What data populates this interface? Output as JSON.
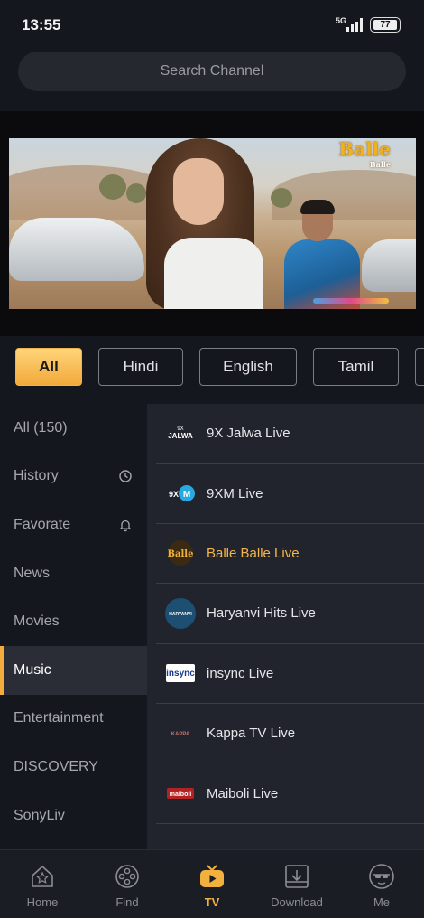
{
  "status_bar": {
    "time": "13:55",
    "network": "5G",
    "battery": "77"
  },
  "search": {
    "placeholder": "Search Channel"
  },
  "player": {
    "channel_logo_text": "Balle",
    "channel_logo_sub": "Balle"
  },
  "languages": [
    {
      "label": "All",
      "active": true
    },
    {
      "label": "Hindi",
      "active": false
    },
    {
      "label": "English",
      "active": false
    },
    {
      "label": "Tamil",
      "active": false
    }
  ],
  "categories": [
    {
      "label": "All (150)",
      "icon": null
    },
    {
      "label": "History",
      "icon": "history-icon"
    },
    {
      "label": "Favorate",
      "icon": "bell-icon"
    },
    {
      "label": "News",
      "icon": null
    },
    {
      "label": "Movies",
      "icon": null
    },
    {
      "label": "Music",
      "icon": null,
      "active": true
    },
    {
      "label": "Entertainment",
      "icon": null
    },
    {
      "label": "DISCOVERY",
      "icon": null
    },
    {
      "label": "SonyLiv",
      "icon": null
    }
  ],
  "channels": [
    {
      "name": "9X Jalwa Live",
      "logo": "JALWA",
      "logo_top": "9X"
    },
    {
      "name": "9XM Live",
      "logo": "9XM"
    },
    {
      "name": "Balle Balle Live",
      "logo": "Balle",
      "active": true
    },
    {
      "name": "Haryanvi Hits Live",
      "logo": "HARYANVI"
    },
    {
      "name": "insync Live",
      "logo": "insync"
    },
    {
      "name": "Kappa TV Live",
      "logo": "KAPPA"
    },
    {
      "name": "Maiboli Live",
      "logo": "maiboli"
    }
  ],
  "tabs": [
    {
      "label": "Home",
      "icon": "home-icon"
    },
    {
      "label": "Find",
      "icon": "film-reel-icon"
    },
    {
      "label": "TV",
      "icon": "tv-icon",
      "active": true
    },
    {
      "label": "Download",
      "icon": "download-icon"
    },
    {
      "label": "Me",
      "icon": "profile-icon"
    }
  ],
  "colors": {
    "accent": "#f2ad3c",
    "background": "#15171f",
    "list_background": "#22242d"
  }
}
